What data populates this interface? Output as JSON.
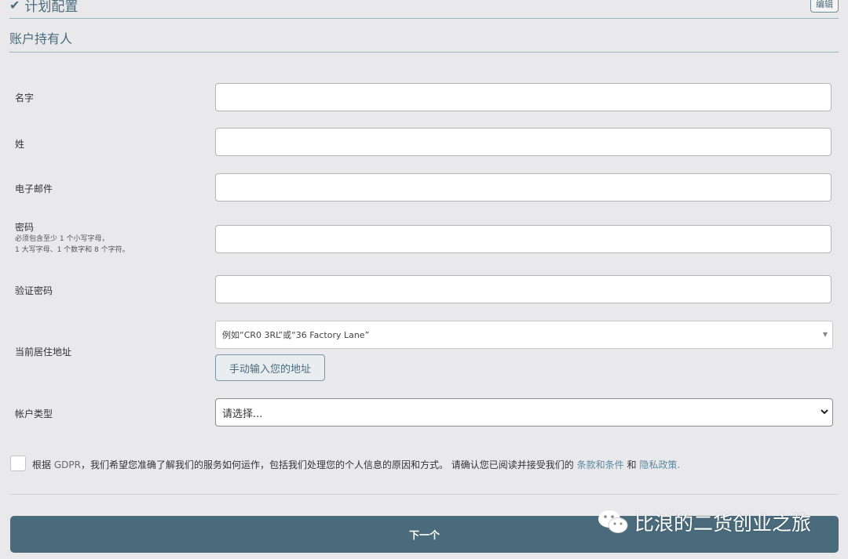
{
  "header": {
    "section_title": "计划配置",
    "edit_label": "编辑"
  },
  "section": {
    "title": "账户持有人"
  },
  "form": {
    "first_name_label": "名字",
    "last_name_label": "姓",
    "email_label": "电子邮件",
    "password_label": "密码",
    "password_hint_line1": "必须包含至少 1 个小写字母，",
    "password_hint_line2": "1 大写字母、1 个数字和 8 个字符。",
    "confirm_password_label": "验证密码",
    "address_label": "当前居住地址",
    "address_placeholder": "例如“CR0 3RL”或“36 Factory Lane”",
    "manual_address_button": "手动输入您的地址",
    "account_type_label": "帐户类型",
    "account_type_selected": "请选择..."
  },
  "consent": {
    "text_prefix": "根据",
    "gdpr_term": "GDPR",
    "text_body": "，我们希望您准确了解我们的服务如何运作，包括我们处理您的个人信息的原因和方式。 请确认您已阅读并接受我们的",
    "terms_link": "条款和条件",
    "and_word": "和",
    "privacy_link": "隐私政策."
  },
  "footer": {
    "next_button": "下一个"
  },
  "watermark": {
    "text": "比浪的二货创业之旅"
  },
  "colors": {
    "accent": "#4a6b7c",
    "link": "#5b8aa2",
    "background": "#e9e9eb"
  },
  "icons": [
    "check-icon",
    "caret-down-icon",
    "chevron-down-icon",
    "wechat-icon"
  ]
}
